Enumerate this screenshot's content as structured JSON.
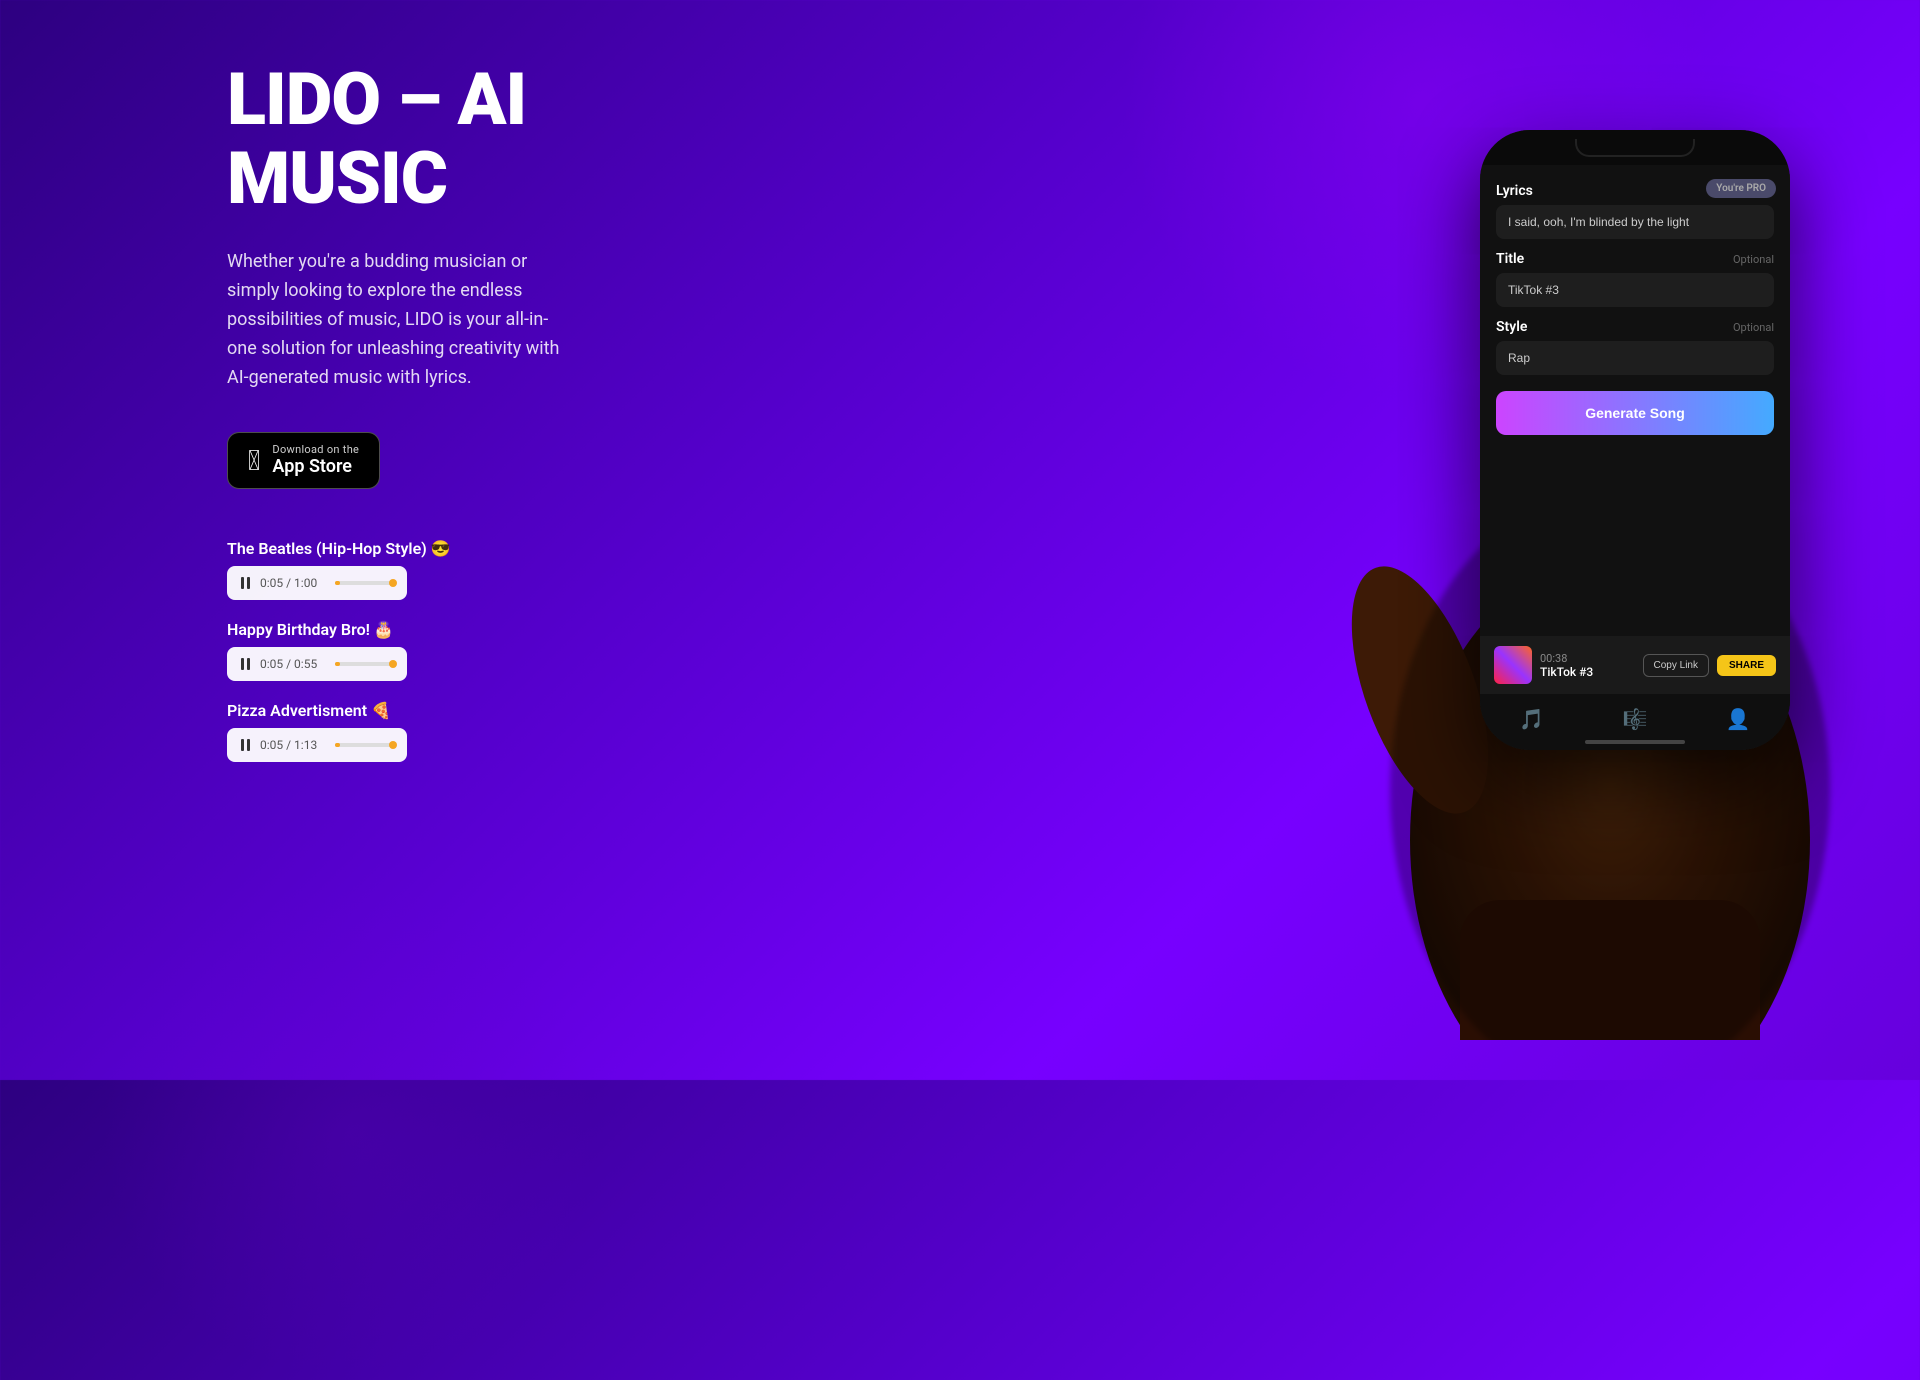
{
  "app": {
    "title_line1": "LIDO – AI",
    "title_line2": "MUSIC",
    "description": "Whether you're a budding musician or simply looking to explore the endless possibilities of music, LIDO is your all-in-one solution for unleashing creativity with AI-generated music with lyrics.",
    "app_store_button": {
      "small_text": "Download on the",
      "big_text": "App Store"
    }
  },
  "songs": [
    {
      "title": "The Beatles (Hip-Hop Style) 😎",
      "time_current": "0:05",
      "time_total": "1:00"
    },
    {
      "title": "Happy Birthday Bro! 🎂",
      "time_current": "0:05",
      "time_total": "0:55"
    },
    {
      "title": "Pizza Advertisment 🍕",
      "time_current": "0:05",
      "time_total": "1:13"
    }
  ],
  "phone": {
    "pro_badge": "You're PRO",
    "lyrics_label": "Lyrics",
    "lyrics_placeholder": "I said, ooh, I'm blinded by the light",
    "title_label": "Title",
    "title_optional": "Optional",
    "title_value": "TikTok #3",
    "style_label": "Style",
    "style_optional": "Optional",
    "style_value": "Rap",
    "generate_button": "Generate Song",
    "player": {
      "time": "00:38",
      "track_name": "TikTok #3",
      "copy_link": "Copy Link",
      "share": "SHARE"
    },
    "nav": {
      "icon1": "🎵",
      "icon2": "🎼",
      "icon3": "👤"
    }
  },
  "colors": {
    "bg_gradient_start": "#2d0080",
    "bg_gradient_end": "#7700ff",
    "accent_yellow": "#f5a623",
    "generate_btn_start": "#cc44ff",
    "generate_btn_end": "#44aaff"
  }
}
